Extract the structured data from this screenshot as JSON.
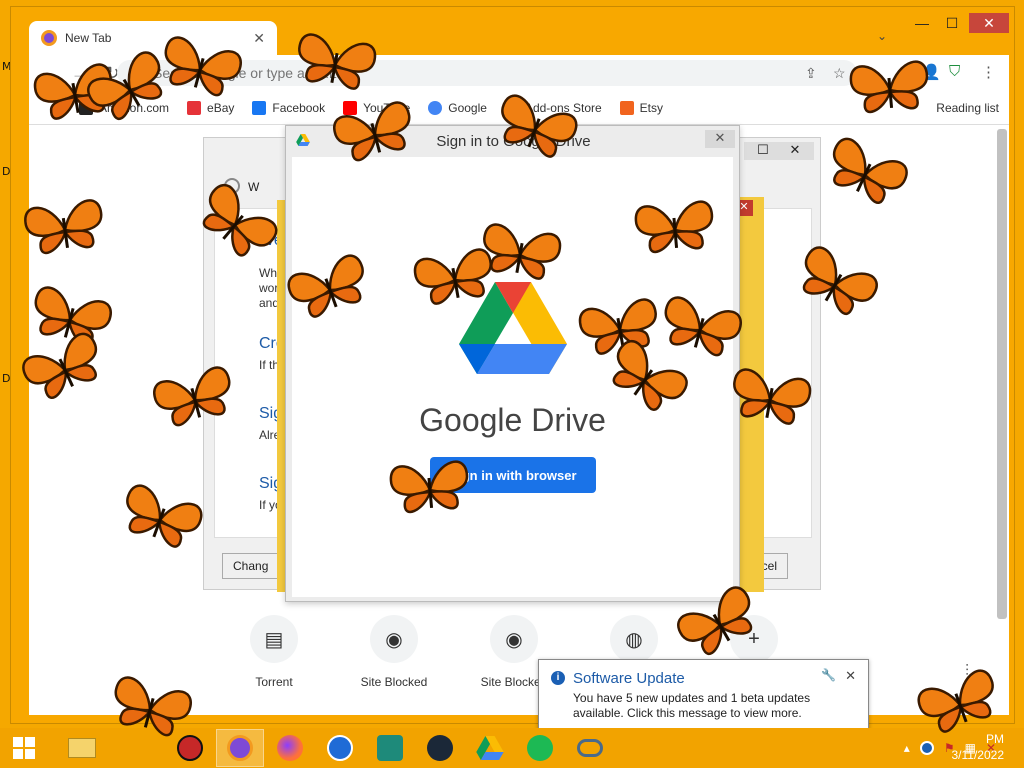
{
  "desktop": {
    "labels": [
      "M",
      "D",
      "D"
    ]
  },
  "browser": {
    "tab_title": "New Tab",
    "tab_close": "✕",
    "window_buttons": {
      "minimize": "—",
      "maximize": "☐",
      "close": "✕"
    },
    "omnibox_placeholder": "Search Google or type a URL",
    "bookmarks": [
      {
        "label": "Amazon.com",
        "color": "#222222"
      },
      {
        "label": "eBay",
        "color": "#e53238"
      },
      {
        "label": "Facebook",
        "color": "#1877f2"
      },
      {
        "label": "YouTube",
        "color": "#ff0000"
      },
      {
        "label": "Google",
        "color": "#4285f4"
      },
      {
        "label": "Add-ons Store",
        "color": "#0f9d58"
      },
      {
        "label": "Etsy",
        "color": "#f1641e"
      }
    ],
    "reading_list": "Reading list",
    "shortcuts": [
      {
        "label": "Torrent",
        "icon": "torrent-icon",
        "glyph": "▤"
      },
      {
        "label": "Site Blocked",
        "icon": "github-icon",
        "glyph": "◉"
      },
      {
        "label": "Site Blocked",
        "icon": "github-icon",
        "glyph": "◉"
      },
      {
        "label": "",
        "icon": "globe-icon",
        "glyph": "◍"
      },
      {
        "label": "",
        "icon": "add-shortcut-icon",
        "glyph": "+"
      }
    ]
  },
  "background_dialog": {
    "window_title_partial": "W",
    "welcome_heading": "Wel",
    "welcome_text": [
      "Whet",
      "work",
      "and e"
    ],
    "option1_heading": "Cre",
    "option1_text": "If th",
    "option2_heading": "Sig",
    "option2_text": "Alre",
    "option3_heading": "Sig",
    "option3_text": "If yo",
    "change_button": "Chang",
    "cancel_button": "ncel"
  },
  "drive_dialog": {
    "title": "Sign in to Google Drive",
    "product_name": "Google Drive",
    "signin_button": "Sign in with browser",
    "close": "✕"
  },
  "notification": {
    "title": "Software Update",
    "message": "You have 5 new updates and 1 beta updates available. Click this message to view more.",
    "close": "✕",
    "settings": "🔧"
  },
  "taskbar": {
    "apps": [
      {
        "name": "file-explorer",
        "glyph": "🗂"
      },
      {
        "name": "antivirus",
        "glyph": "◈"
      },
      {
        "name": "browser-active",
        "glyph": "◐"
      },
      {
        "name": "firefox",
        "glyph": "🦊"
      },
      {
        "name": "thunderbird",
        "glyph": "✉"
      },
      {
        "name": "vpn",
        "glyph": "◆"
      },
      {
        "name": "steam",
        "glyph": "⚙"
      },
      {
        "name": "google-drive",
        "glyph": "▲"
      },
      {
        "name": "spotify",
        "glyph": "◎"
      },
      {
        "name": "network-tool",
        "glyph": "⛓"
      }
    ],
    "clock_time": "PM",
    "clock_date": "3/11/2022"
  }
}
